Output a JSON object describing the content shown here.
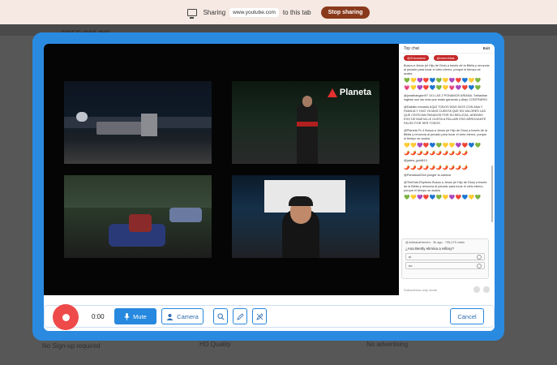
{
  "share_bar": {
    "prefix": "Sharing",
    "url": "www.youtube.com",
    "suffix": "to this tab",
    "stop_label": "Stop sharing"
  },
  "background_page": {
    "title": "FREE ONLINE",
    "footer_1": "No Sign-up required",
    "footer_2": "HD Quality",
    "footer_3": "No advertising"
  },
  "video": {
    "channel_logo": "Planeta"
  },
  "chat": {
    "header_title": "Top chat",
    "exit_label": "Exit",
    "pinned": [
      "@Zhicambal",
      "@mmmhhaL"
    ],
    "messages": [
      "Busca a Jesús (el Hijo de Dios) a través de la Biblia y renuncia al pecado para tocar el cielo eterno, porque el tiempo se acaba",
      "@jonathanglan97 101 LAS 2 PONAMOS ARIANA. Sebastian inglese son las más que están ganando y Alejo CONTRARIO",
      "@Diablito encanto AQUÍ TODOS DÍAS DIOS CON ANA Y FAMILIA Y HIJO YA MAS CUENTA QUE EN VALORES LAS QUE CRITICAN PASADOS POR SU BELLEZA, ADEMÁS ESO DE MUEVA LE GUSTA A PALLARI ESO ARROGANTE FALSO POR SER TODOS",
      "@Planeta Fc 4 Busca a Jesús (el Hijo de Dios) a través de la Biblia y renuncia al pecado para tocar el cielo eterno, porque el tiempo se acaba",
      "@jadea_gold613",
      "@Pantalcal20cd ponger la cabeza",
      "@TheKids-Rhythms Busca a Jesús (el Hijo de Dios) a través de la Biblia y renuncia al pecado para tocar el cielo eterno, porque el tiempo se acaba"
    ],
    "poll": {
      "meta": "@JohhanaHenrim · 3h ago · 735,279 votes",
      "question": "¿Ana Bently elimina a Hillary?",
      "options": [
        "si",
        "no"
      ]
    },
    "footer": "Subscribers-only mode"
  },
  "controls": {
    "timer": "0:00",
    "mute_label": "Mute",
    "camera_label": "Camera",
    "cancel_label": "Cancel"
  },
  "colors": {
    "panel_blue": "#2a8ae0",
    "record_red": "#ee4a4a",
    "stop_brown": "#8a3a1c"
  }
}
